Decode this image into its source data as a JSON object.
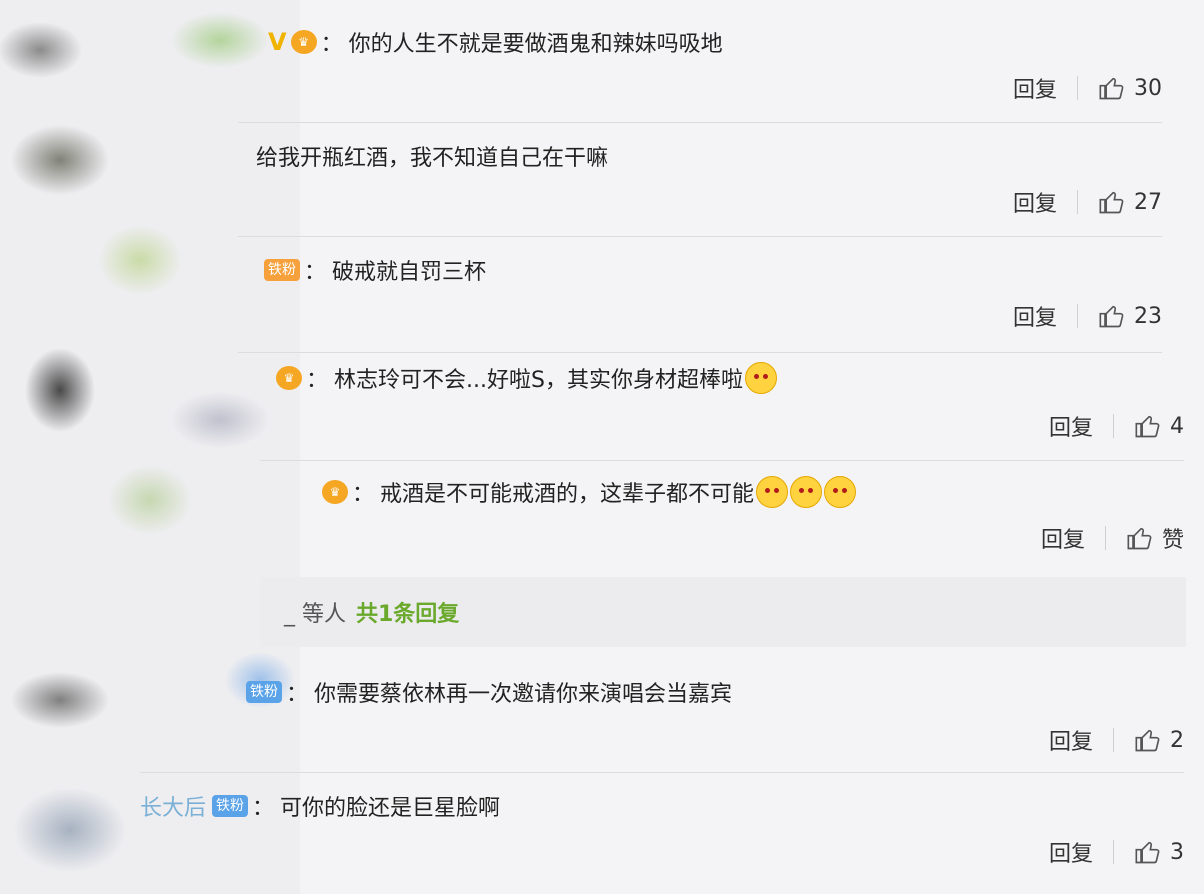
{
  "comments": [
    {
      "text": "你的人生不就是要做酒鬼和辣妹吗吸地",
      "reply": "回复",
      "likes": "30"
    },
    {
      "text": "给我开瓶红酒，我不知道自己在干嘛",
      "reply": "回复",
      "likes": "27"
    },
    {
      "badge": "铁粉",
      "text": "破戒就自罚三杯",
      "reply": "回复",
      "likes": "23"
    },
    {
      "text": "林志玲可不会...好啦S，其实你身材超棒啦",
      "reply": "回复",
      "likes": "4"
    },
    {
      "text": "戒酒是不可能戒酒的，这辈子都不可能",
      "reply": "回复",
      "likes": "赞"
    },
    {
      "badge": "铁粉",
      "text": "你需要蔡依林再一次邀请你来演唱会当嘉宾",
      "reply": "回复",
      "likes": "2"
    },
    {
      "username": "长大后",
      "badge": "铁粉",
      "text": "可你的脸还是巨星脸啊",
      "reply": "回复",
      "likes": "3"
    }
  ],
  "more_replies": {
    "user": "_ 等人",
    "count": "共1条回复"
  },
  "colon": "：",
  "icons": {
    "like": "thumbs-up-icon",
    "vip": "vip-crown-icon",
    "emoji": "doge-emoji-icon"
  },
  "colors": {
    "accent_green": "#6aa92c",
    "badge_orange": "#f6a13c",
    "badge_blue": "#5aa3e8"
  }
}
